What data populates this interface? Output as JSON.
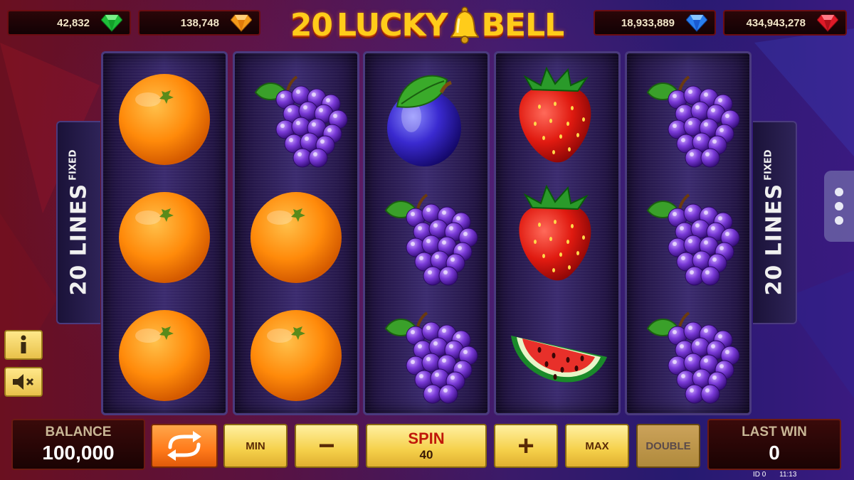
{
  "game": {
    "logo": {
      "part1": "20",
      "part2": "LUCKY",
      "part3": "BELL"
    }
  },
  "jackpots": [
    {
      "value": "42,832",
      "gem": "green-gem-icon",
      "color": "#1fbf3a"
    },
    {
      "value": "138,748",
      "gem": "orange-gem-icon",
      "color": "#f39a1a"
    },
    {
      "value": "18,933,889",
      "gem": "blue-gem-icon",
      "color": "#2a7ff0"
    },
    {
      "value": "434,943,278",
      "gem": "red-gem-icon",
      "color": "#e01a28"
    }
  ],
  "reels": [
    [
      "orange",
      "orange",
      "orange"
    ],
    [
      "grapes",
      "orange",
      "orange"
    ],
    [
      "plum",
      "grapes",
      "grapes"
    ],
    [
      "strawberry",
      "strawberry",
      "watermelon"
    ],
    [
      "grapes",
      "grapes",
      "grapes"
    ]
  ],
  "lines_panel": {
    "count_label": "20 LINES",
    "mode_label": "FIXED"
  },
  "bottom": {
    "balance_label": "BALANCE",
    "balance_value": "100,000",
    "min_label": "MIN",
    "minus_label": "−",
    "spin_label": "SPIN",
    "bet_value": "40",
    "plus_label": "+",
    "max_label": "MAX",
    "double_label": "DOUBLE",
    "last_win_label": "LAST WIN",
    "last_win_value": "0"
  },
  "footer": {
    "id_text": "ID 0",
    "time_text": "11:13"
  },
  "icons": {
    "info": "info-icon",
    "sound": "mute-speaker-icon",
    "autoplay": "autoplay-icon",
    "menu": "more-dots-icon"
  }
}
